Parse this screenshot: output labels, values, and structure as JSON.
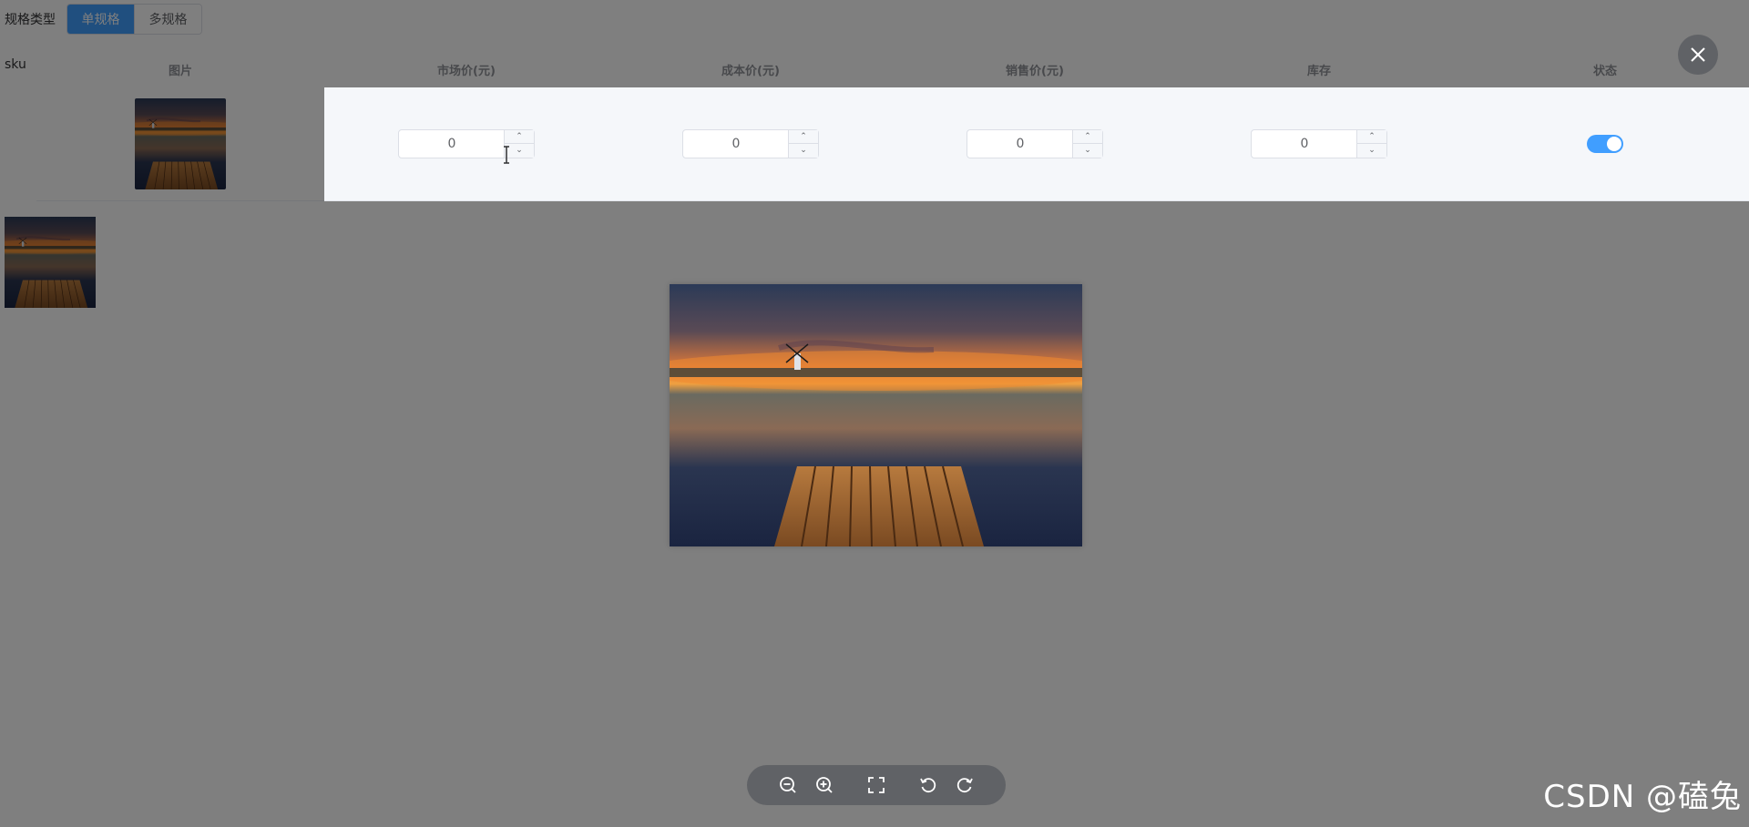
{
  "spec": {
    "label": "规格类型",
    "options": [
      "单规格",
      "多规格"
    ],
    "selected": "单规格"
  },
  "sku_label": "sku",
  "table": {
    "headers": [
      "图片",
      "市场价(元)",
      "成本价(元)",
      "销售价(元)",
      "库存",
      "状态"
    ],
    "row": {
      "market_price": "0",
      "cost_price": "0",
      "sale_price": "0",
      "stock": "0",
      "status_on": true
    }
  },
  "viewer": {
    "tools": [
      "zoom-out-icon",
      "zoom-in-icon",
      "fullscreen-icon",
      "rotate-left-icon",
      "rotate-right-icon"
    ]
  },
  "watermark": "CSDN @磕兔",
  "colors": {
    "primary": "#409eff",
    "mask": "rgba(0,0,0,0.5)",
    "toolbar": "#606266"
  }
}
